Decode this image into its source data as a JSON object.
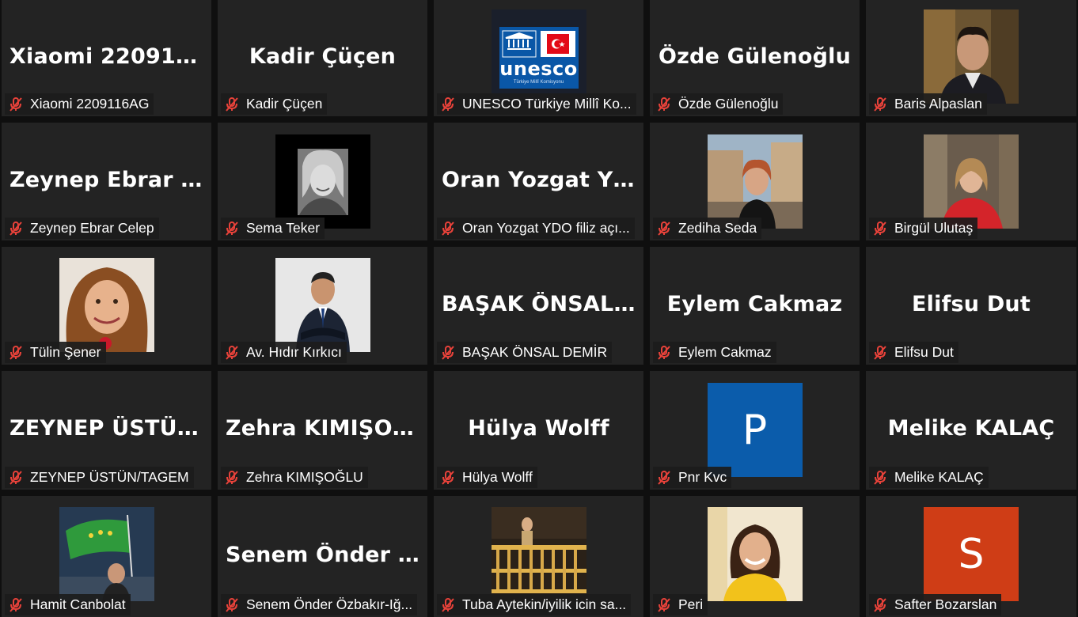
{
  "colors": {
    "tile_bg": "#232323",
    "mic_muted": "#e8423a",
    "avatar_blue": "#0b5cab",
    "avatar_orange": "#cf3d16"
  },
  "participants": [
    {
      "name": "Xiaomi 2209116AG",
      "big": "Xiaomi  220911...",
      "type": "name"
    },
    {
      "name": "Kadir Çüçen",
      "big": "Kadir Çüçen",
      "type": "name"
    },
    {
      "name": "UNESCO Türkiye Millî Ko...",
      "type": "logo",
      "logo_text": "unesco",
      "logo_sub": "Türkiye Millî Komisyonu"
    },
    {
      "name": "Özde Gülenoğlu",
      "big": "Özde Gülenoğlu",
      "type": "name"
    },
    {
      "name": "Baris Alpaslan",
      "type": "photo",
      "photo": "man-suit"
    },
    {
      "name": "Zeynep Ebrar Celep",
      "big": "Zeynep  Ebrar  C...",
      "type": "name"
    },
    {
      "name": "Sema Teker",
      "type": "photo",
      "photo": "bw-woman"
    },
    {
      "name": "Oran Yozgat YDO filiz açı...",
      "big": "Oran  Yozgat  YD...",
      "type": "name"
    },
    {
      "name": "Zediha Seda",
      "type": "photo",
      "photo": "street-woman"
    },
    {
      "name": "Birgül Ulutaş",
      "type": "photo",
      "photo": "red-jacket-woman"
    },
    {
      "name": "Tülin Şener",
      "type": "photo",
      "photo": "smiling-woman"
    },
    {
      "name": "Av. Hıdır Kırkıcı",
      "type": "photo",
      "photo": "man-crossed-arms"
    },
    {
      "name": "BAŞAK ÖNSAL DEMİR",
      "big": "BAŞAK  ÖNSAL...",
      "type": "name"
    },
    {
      "name": "Eylem Cakmaz",
      "big": "Eylem Cakmaz",
      "type": "name"
    },
    {
      "name": "Elifsu Dut",
      "big": "Elifsu Dut",
      "type": "name"
    },
    {
      "name": "ZEYNEP ÜSTÜN/TAGEM",
      "big": "ZEYNEP  ÜSTÜN...",
      "type": "name"
    },
    {
      "name": "Zehra KIMIŞOĞLU",
      "big": "Zehra  KIMIŞOĞ...",
      "type": "name"
    },
    {
      "name": "Hülya Wolff",
      "big": "Hülya Wolff",
      "type": "name"
    },
    {
      "name": "Pnr Kvc",
      "type": "letter",
      "letter": "P",
      "color": "#0b5cab"
    },
    {
      "name": "Melike KALAÇ",
      "big": "Melike KALAÇ",
      "type": "name"
    },
    {
      "name": "Hamit Canbolat",
      "type": "photo",
      "photo": "flag-man"
    },
    {
      "name": "Senem Önder Özbakır-Iğ...",
      "big": "Senem  Önder  Ö...",
      "type": "name"
    },
    {
      "name": "Tuba Aytekin/iyilik icin sa...",
      "type": "photo",
      "photo": "balcony"
    },
    {
      "name": "Peri",
      "type": "photo",
      "photo": "yellow-woman"
    },
    {
      "name": "Safter Bozarslan",
      "type": "letter",
      "letter": "S",
      "color": "#cf3d16"
    }
  ]
}
